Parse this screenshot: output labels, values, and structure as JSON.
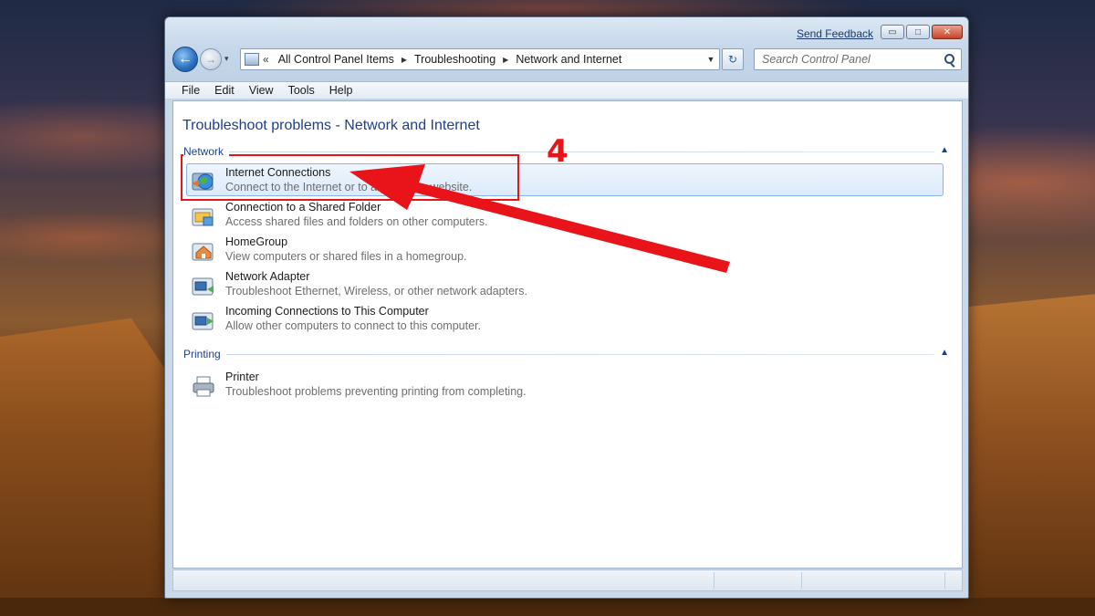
{
  "window": {
    "send_feedback": "Send Feedback",
    "minimize_glyph": "▭",
    "maximize_glyph": "□",
    "close_glyph": "✕"
  },
  "nav": {
    "back_glyph": "←",
    "forward_glyph": "→",
    "recent_glyph": "▾",
    "address_prefix": "«",
    "breadcrumbs": [
      "All Control Panel Items",
      "Troubleshooting",
      "Network and Internet"
    ],
    "crumb_separator": "▶",
    "dropdown_glyph": "▼",
    "refresh_glyph": "↻",
    "search_placeholder": "Search Control Panel"
  },
  "menubar": {
    "items": [
      "File",
      "Edit",
      "View",
      "Tools",
      "Help"
    ]
  },
  "main": {
    "title": "Troubleshoot problems - Network and Internet",
    "collapse_glyph": "▲",
    "groups": [
      {
        "label": "Network",
        "items": [
          {
            "name": "Internet Connections",
            "description": "Connect to the Internet or to a particular website.",
            "icon": "internet-globe-icon",
            "selected": true
          },
          {
            "name": "Connection to a Shared Folder",
            "description": "Access shared files and folders on other computers.",
            "icon": "shared-folder-icon",
            "selected": false
          },
          {
            "name": "HomeGroup",
            "description": "View computers or shared files in a homegroup.",
            "icon": "homegroup-icon",
            "selected": false
          },
          {
            "name": "Network Adapter",
            "description": "Troubleshoot Ethernet, Wireless, or other network adapters.",
            "icon": "network-adapter-icon",
            "selected": false
          },
          {
            "name": "Incoming Connections to This Computer",
            "description": "Allow other computers to connect to this computer.",
            "icon": "incoming-connections-icon",
            "selected": false
          }
        ]
      },
      {
        "label": "Printing",
        "items": [
          {
            "name": "Printer",
            "description": "Troubleshoot problems preventing printing from completing.",
            "icon": "printer-icon",
            "selected": false
          }
        ]
      }
    ]
  },
  "annotation": {
    "step_number": "4",
    "color": "#e8141a"
  }
}
